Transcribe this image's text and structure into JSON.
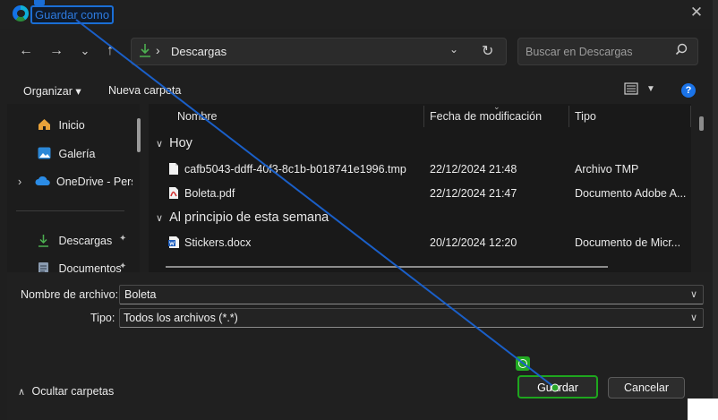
{
  "window": {
    "title": "Guardar como",
    "close_glyph": "✕"
  },
  "nav": {
    "back": "←",
    "forward": "→",
    "recent": "⌄",
    "up": "↑"
  },
  "address": {
    "separator": "›",
    "location": "Descargas",
    "dropdown": "⌄",
    "refresh": "↻"
  },
  "search": {
    "placeholder": "Buscar en Descargas",
    "icon": "search-icon"
  },
  "toolbar": {
    "organize": "Organizar ▾",
    "new_folder": "Nueva carpeta",
    "help": "?"
  },
  "sidebar": {
    "items": [
      {
        "label": "Inicio",
        "icon": "home-icon"
      },
      {
        "label": "Galería",
        "icon": "gallery-icon"
      },
      {
        "label": "OneDrive - Perso",
        "icon": "cloud-icon",
        "expand": "›"
      },
      {
        "label": "Descargas",
        "icon": "download-icon",
        "pin": "📌"
      },
      {
        "label": "Documentos",
        "icon": "documents-icon",
        "pin": "📌"
      }
    ]
  },
  "files": {
    "columns": [
      "Nombre",
      "Fecha de modificación",
      "Tipo"
    ],
    "groups": [
      {
        "label": "Hoy",
        "rows": [
          {
            "name": "cafb5043-ddff-40f3-8c1b-b018741e1996.tmp",
            "date": "22/12/2024 21:48",
            "type": "Archivo TMP",
            "icon": "file-icon"
          },
          {
            "name": "Boleta.pdf",
            "date": "22/12/2024 21:47",
            "type": "Documento Adobe A...",
            "icon": "pdf-icon"
          }
        ]
      },
      {
        "label": "Al principio de esta semana",
        "rows": [
          {
            "name": "Stickers.docx",
            "date": "20/12/2024 12:20",
            "type": "Documento de Micr...",
            "icon": "word-icon"
          }
        ]
      }
    ]
  },
  "form": {
    "filename_label": "Nombre de archivo:",
    "filename_value": "Boleta",
    "type_label": "Tipo:",
    "type_value": "Todos los archivos (*.*)"
  },
  "footer": {
    "hide_folders": "Ocultar carpetas",
    "save": "Guardar",
    "cancel": "Cancelar"
  },
  "colors": {
    "accent": "#1a73e8",
    "highlight": "#1ea61e",
    "annotation": "#1a6ed6"
  }
}
